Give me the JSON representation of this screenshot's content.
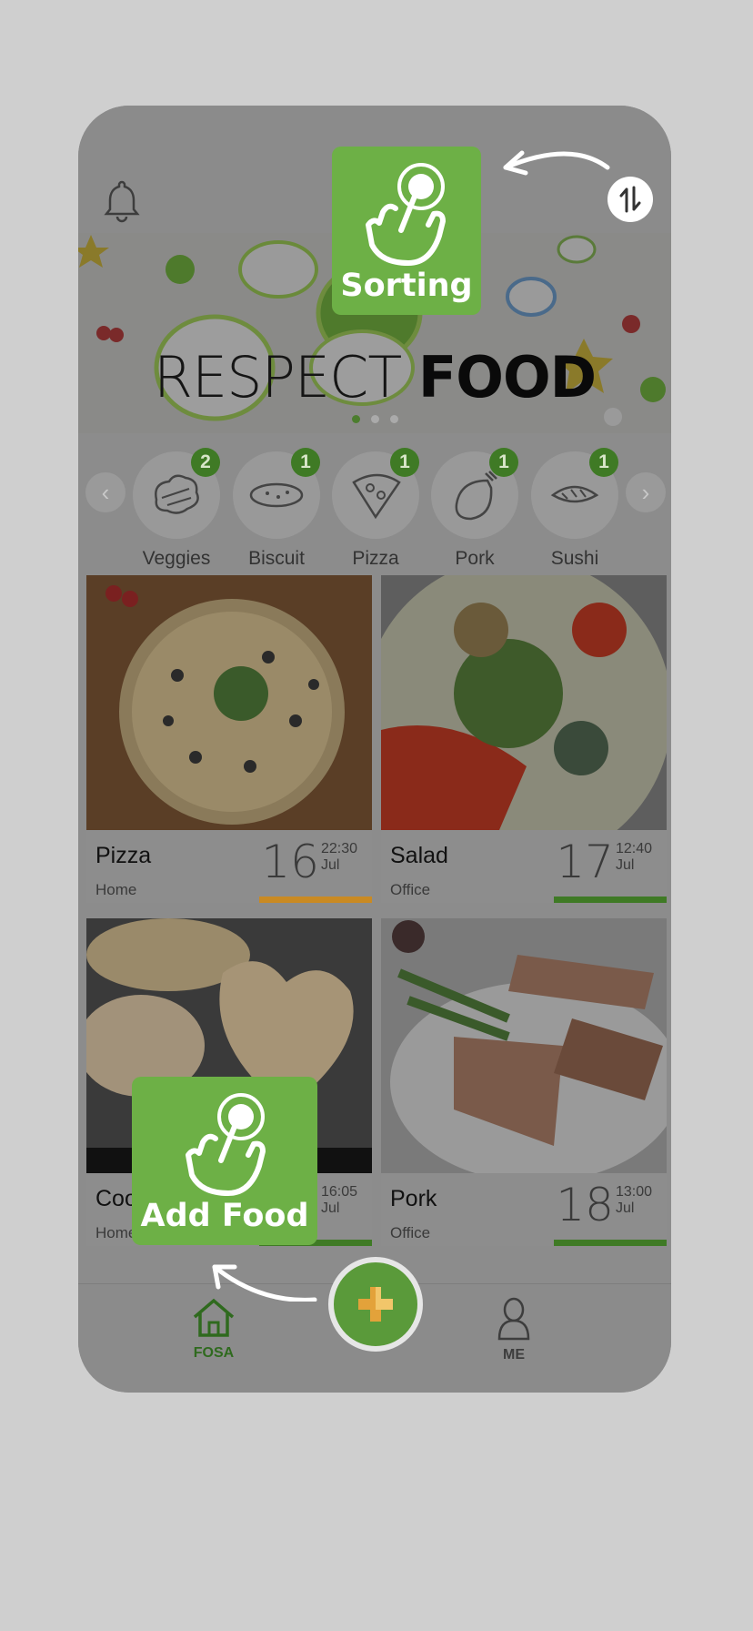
{
  "categories": [
    {
      "label": "Veggies",
      "count": "2",
      "icon": "veggies-icon"
    },
    {
      "label": "Biscuit",
      "count": "1",
      "icon": "biscuit-icon"
    },
    {
      "label": "Pizza",
      "count": "1",
      "icon": "pizza-icon"
    },
    {
      "label": "Pork",
      "count": "1",
      "icon": "pork-icon"
    },
    {
      "label": "Sushi",
      "count": "1",
      "icon": "sushi-icon"
    }
  ],
  "banner": {
    "title_light": "RESPECT ",
    "title_bold": "FOOD",
    "slides": 3,
    "active_slide": 1
  },
  "foods": [
    {
      "name": "Pizza",
      "place": "Home",
      "day": "16",
      "time": "22:30",
      "month": "Jul",
      "bar_color": "#c98a23"
    },
    {
      "name": "Salad",
      "place": "Office",
      "day": "17",
      "time": "12:40",
      "month": "Jul",
      "bar_color": "#3f7a25"
    },
    {
      "name": "Cookie",
      "place": "Home",
      "day": "",
      "time": "16:05",
      "month": "Jul",
      "bar_color": "#3f7a25"
    },
    {
      "name": "Pork",
      "place": "Office",
      "day": "18",
      "time": "13:00",
      "month": "Jul",
      "bar_color": "#3f7a25"
    }
  ],
  "nav": {
    "home_label": "FOSA",
    "me_label": "ME"
  },
  "tips": {
    "sorting": "Sorting",
    "add_food": "Add Food"
  },
  "colors": {
    "accent_green": "#6db046",
    "dark_green": "#3f7a25",
    "orange": "#c98a23"
  }
}
